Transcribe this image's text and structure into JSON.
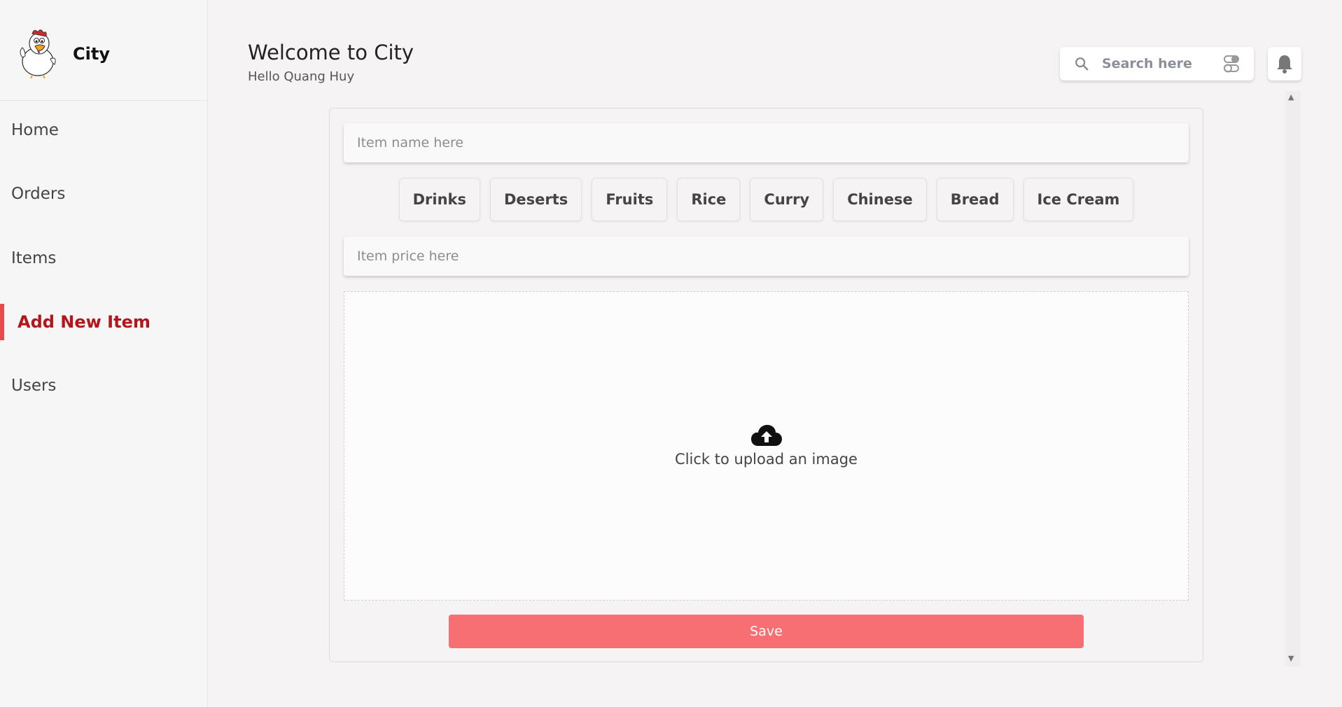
{
  "sidebar": {
    "brand": "City",
    "items": [
      {
        "label": "Home"
      },
      {
        "label": "Orders"
      },
      {
        "label": "Items"
      },
      {
        "label": "Add New Item"
      },
      {
        "label": "Users"
      }
    ],
    "active_item": "Add New Item"
  },
  "header": {
    "title": "Welcome to City",
    "subtitle": "Hello Quang Huy",
    "search_placeholder": "Search here"
  },
  "form": {
    "name_placeholder": "Item name here",
    "categories": [
      "Drinks",
      "Deserts",
      "Fruits",
      "Rice",
      "Curry",
      "Chinese",
      "Bread",
      "Ice Cream"
    ],
    "price_placeholder": "Item price here",
    "upload_label": "Click to upload an image",
    "save_label": "Save"
  },
  "colors": {
    "accent": "#e84a4f",
    "active_text": "#b3151b",
    "save_button": "#f76f72"
  },
  "icons": [
    "search-icon",
    "filter-icon",
    "bell-icon",
    "cloud-upload-icon",
    "chicken-logo"
  ]
}
